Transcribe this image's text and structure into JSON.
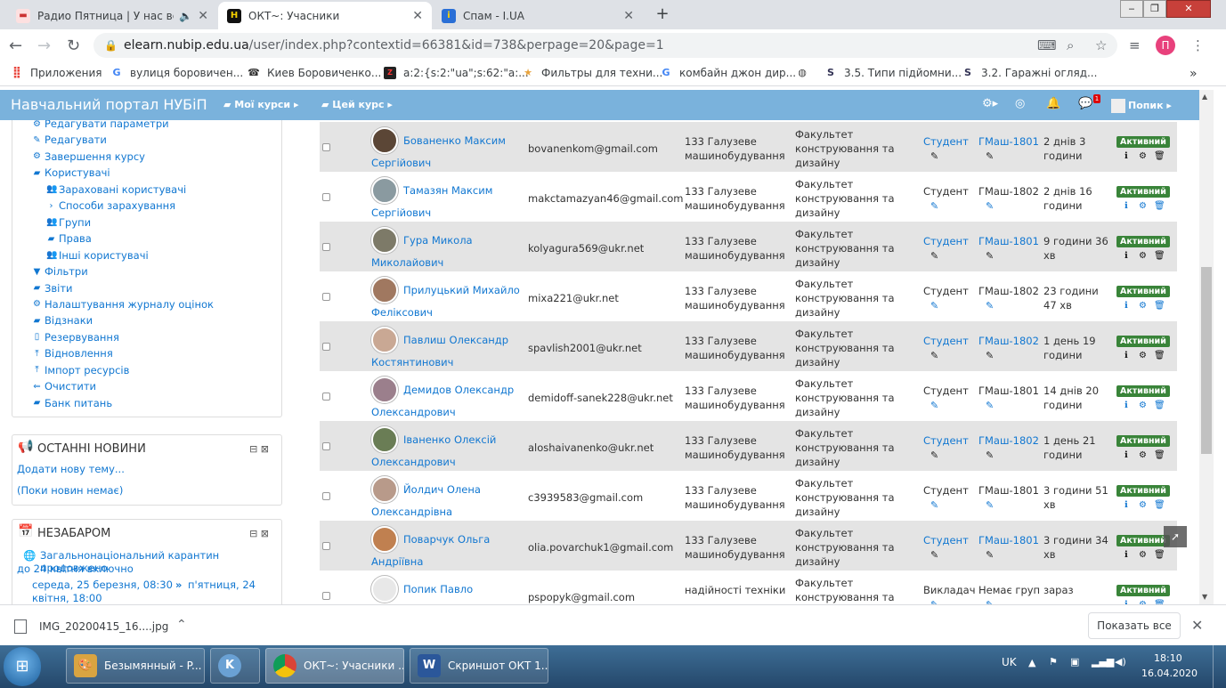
{
  "browser": {
    "tabs": [
      {
        "title": "Радио Пятница | У нас всегд",
        "active": false
      },
      {
        "title": "ОКТ~: Учасники",
        "active": true
      },
      {
        "title": "Спам - I.UA",
        "active": false
      }
    ],
    "new_tab": "+",
    "url_host": "elearn.nubip.edu.ua",
    "url_path": "/user/index.php?contextid=66381&id=738&perpage=20&page=1",
    "profile_letter": "П",
    "bookmarks": [
      "Приложения",
      "вулиця боровичен...",
      "Киев Боровиченко...",
      "a:2:{s:2:\"ua\";s:62:\"a:...",
      "Фильтры для техни...",
      "комбайн джон дир...",
      "",
      "3.5. Типи підйомни...",
      "3.2. Гаражні огляд..."
    ],
    "bookmarks_more": "»"
  },
  "moodle": {
    "brand": "Навчальний портал НУБіП",
    "my_courses": "Мої курси",
    "this_course": "Цей курс",
    "user_name": "Попик",
    "message_count": "1"
  },
  "sidebar": {
    "items": [
      {
        "label": "Редагувати параметри",
        "icon": "gear-icon"
      },
      {
        "label": "Редагувати",
        "icon": "pencil-icon"
      },
      {
        "label": "Завершення курсу",
        "icon": "gear-icon"
      },
      {
        "label": "Користувачі",
        "icon": "folder-open-icon"
      },
      {
        "label": "Зараховані користувачі",
        "icon": "users-icon"
      },
      {
        "label": "Способи зарахування",
        "icon": "chevron-right-icon"
      },
      {
        "label": "Групи",
        "icon": "users-icon"
      },
      {
        "label": "Права",
        "icon": "folder-icon"
      },
      {
        "label": "Інші користувачі",
        "icon": "users-icon"
      },
      {
        "label": "Фільтри",
        "icon": "filter-icon"
      },
      {
        "label": "Звіти",
        "icon": "folder-icon"
      },
      {
        "label": "Налаштування журналу оцінок",
        "icon": "gear-icon"
      },
      {
        "label": "Відзнаки",
        "icon": "folder-icon"
      },
      {
        "label": "Резервування",
        "icon": "file-icon"
      },
      {
        "label": "Відновлення",
        "icon": "upload-icon"
      },
      {
        "label": "Імпорт ресурсів",
        "icon": "upload-icon"
      },
      {
        "label": "Очистити",
        "icon": "arrow-left-icon"
      },
      {
        "label": "Банк питань",
        "icon": "folder-icon"
      }
    ]
  },
  "news_block": {
    "title": "ОСТАННІ НОВИНИ",
    "add_topic": "Додати нову тему...",
    "empty": "(Поки новин немає)"
  },
  "upcoming_block": {
    "title": "НЕЗАБАРОМ",
    "event_title_line1": "Загальнонаціональний карантин продовжено",
    "event_title_line2": "до 24 квітня включно",
    "event_time_line1": "середа, 25 березня, 08:30",
    "event_time_arrow": "»",
    "event_time_line1b": "п'ятниця, 24",
    "event_time_line2": "квітня, 18:00"
  },
  "participants": [
    {
      "name1": "Бованенко Максим",
      "name2": "Сергійович",
      "email": "bovanenkom@gmail.com",
      "spec1": "133 Галузеве",
      "spec2": "машинобудування",
      "fac1": "Факультет",
      "fac2": "конструювання та",
      "fac3": "дизайну",
      "role": "Студент",
      "role_link": true,
      "group": "ГМаш-1801",
      "group_link": true,
      "last1": "2 днів 3",
      "last2": "години",
      "status": "Активний",
      "avatar": "#5b4636"
    },
    {
      "name1": "Тамазян Максим",
      "name2": "Сергійович",
      "email": "makctamazyan46@gmail.com",
      "spec1": "133 Галузеве",
      "spec2": "машинобудування",
      "fac1": "Факультет",
      "fac2": "конструювання та",
      "fac3": "дизайну",
      "role": "Студент",
      "role_link": false,
      "group": "ГМаш-1802",
      "group_link": false,
      "last1": "2 днів 16",
      "last2": "години",
      "status": "Активний",
      "avatar": "#8a9aa0"
    },
    {
      "name1": "Гура Микола",
      "name2": "Миколайович",
      "email": "kolyagura569@ukr.net",
      "spec1": "133 Галузеве",
      "spec2": "машинобудування",
      "fac1": "Факультет",
      "fac2": "конструювання та",
      "fac3": "дизайну",
      "role": "Студент",
      "role_link": true,
      "group": "ГМаш-1801",
      "group_link": true,
      "last1": "9 години 36",
      "last2": "хв",
      "status": "Активний",
      "avatar": "#7d7a68"
    },
    {
      "name1": "Прилуцький Михайло",
      "name2": "Феліксович",
      "email": "mixa221@ukr.net",
      "spec1": "133 Галузеве",
      "spec2": "машинобудування",
      "fac1": "Факультет",
      "fac2": "конструювання та",
      "fac3": "дизайну",
      "role": "Студент",
      "role_link": false,
      "group": "ГМаш-1802",
      "group_link": false,
      "last1": "23 години",
      "last2": "47 хв",
      "status": "Активний",
      "avatar": "#a07860"
    },
    {
      "name1": "Павлиш Олександр",
      "name2": "Костянтинович",
      "email": "spavlish2001@ukr.net",
      "spec1": "133 Галузеве",
      "spec2": "машинобудування",
      "fac1": "Факультет",
      "fac2": "конструювання та",
      "fac3": "дизайну",
      "role": "Студент",
      "role_link": true,
      "group": "ГМаш-1802",
      "group_link": true,
      "last1": "1 день 19",
      "last2": "години",
      "status": "Активний",
      "avatar": "#c9a894"
    },
    {
      "name1": "Демидов Олександр",
      "name2": "Олександрович",
      "email": "demidoff-sanek228@ukr.net",
      "spec1": "133 Галузеве",
      "spec2": "машинобудування",
      "fac1": "Факультет",
      "fac2": "конструювання та",
      "fac3": "дизайну",
      "role": "Студент",
      "role_link": false,
      "group": "ГМаш-1801",
      "group_link": false,
      "last1": "14 днів 20",
      "last2": "години",
      "status": "Активний",
      "avatar": "#9b7f8c"
    },
    {
      "name1": "Іваненко Олексій",
      "name2": "Олександрович",
      "email": "aloshaivanenko@ukr.net",
      "spec1": "133 Галузеве",
      "spec2": "машинобудування",
      "fac1": "Факультет",
      "fac2": "конструювання та",
      "fac3": "дизайну",
      "role": "Студент",
      "role_link": true,
      "group": "ГМаш-1802",
      "group_link": true,
      "last1": "1 день 21",
      "last2": "години",
      "status": "Активний",
      "avatar": "#6a7d55"
    },
    {
      "name1": "Йолдич Олена",
      "name2": "Олександрівна",
      "email": "c3939583@gmail.com",
      "spec1": "133 Галузеве",
      "spec2": "машинобудування",
      "fac1": "Факультет",
      "fac2": "конструювання та",
      "fac3": "дизайну",
      "role": "Студент",
      "role_link": false,
      "group": "ГМаш-1801",
      "group_link": false,
      "last1": "3 години 51",
      "last2": "хв",
      "status": "Активний",
      "avatar": "#b89a8a"
    },
    {
      "name1": "Поварчук Ольга",
      "name2": "Андріївна",
      "email": "olia.povarchuk1@gmail.com",
      "spec1": "133 Галузеве",
      "spec2": "машинобудування",
      "fac1": "Факультет",
      "fac2": "конструювання та",
      "fac3": "дизайну",
      "role": "Студент",
      "role_link": true,
      "group": "ГМаш-1801",
      "group_link": true,
      "last1": "3 години 34",
      "last2": "хв",
      "status": "Активний",
      "avatar": "#c08050"
    },
    {
      "name1": "Попик Павло",
      "name2": "",
      "email": "pspopyk@gmail.com",
      "spec1": "надійності техніки",
      "spec2": "",
      "fac1": "Факультет",
      "fac2": "конструювання та",
      "fac3": "",
      "role": "Викладач",
      "role_link": false,
      "group": "Немає груп",
      "group_link": false,
      "last1": "зараз",
      "last2": "",
      "status": "Активний",
      "avatar": "#e8e8e8"
    }
  ],
  "downloads": {
    "file": "IMG_20200415_16....jpg",
    "show_all": "Показать все"
  },
  "taskbar": {
    "items": [
      "Безымянный - P...",
      "",
      "ОКТ~: Учасники ...",
      "Скриншот ОКТ 1..."
    ],
    "lang": "UK",
    "time": "18:10",
    "date": "16.04.2020"
  },
  "colors": {
    "moodle_bar": "#7ab2dc",
    "link": "#1177d1",
    "active_badge": "#398439",
    "row_stripe": "#e4e4e4"
  }
}
